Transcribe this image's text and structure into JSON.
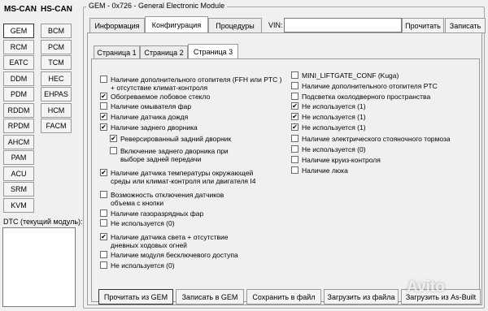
{
  "buses": {
    "ms_can": "MS-CAN",
    "hs_can": "HS-CAN"
  },
  "ms_modules": [
    "GEM",
    "RCM",
    "EATC",
    "DDM",
    "PDM",
    "RDDM",
    "RPDM",
    "AHCM",
    "PAM",
    "ACU",
    "SRM",
    "KVM"
  ],
  "hs_modules": [
    "BCM",
    "PCM",
    "TCM",
    "HEC",
    "EHPAS",
    "HCM",
    "FACM"
  ],
  "dtc_label": "DTC (текущий модуль):",
  "module_title": "GEM - 0x726 - General Electronic Module",
  "tabs": [
    "Информация",
    "Конфигурация",
    "Процедуры"
  ],
  "vin_label": "VIN:",
  "vin_value": "",
  "read_button": "Прочитать",
  "write_button": "Записать",
  "subtabs": [
    "Страница 1",
    "Страница 2",
    "Страница 3"
  ],
  "left_options": [
    {
      "label": "Наличие дополнительного отопителя (FFH или PTC )",
      "label2": "+ отсутствие климат-контроля",
      "checked": false
    },
    {
      "label": "Обогреваемое лобовое стекло",
      "checked": true
    },
    {
      "label": "Наличие омывателя фар",
      "checked": false
    },
    {
      "label": "Наличие датчика дождя",
      "checked": true
    },
    {
      "label": "Наличие заднего дворника",
      "checked": true
    },
    {
      "label": "Реверсированный задний дворник",
      "checked": true
    },
    {
      "label": "Включение заднего дворника при",
      "label2": "выборе задней передачи",
      "checked": false
    },
    {
      "label": "Наличие датчика температуры окружающей",
      "label2": "среды или климат-контроля или двигателя I4",
      "checked": true
    },
    {
      "label": "Возможность отключения датчиков",
      "label2": "объема с кнопки",
      "checked": false
    },
    {
      "label": "Наличие газоразрядных фар",
      "checked": false
    },
    {
      "label": "Не используется (0)",
      "checked": false
    },
    {
      "label": "Наличие датчика света + отсутствие",
      "label2": "дневных ходовых огней",
      "checked": true
    },
    {
      "label": "Наличие модуля бесключевого доступа",
      "checked": false
    },
    {
      "label": "Не используется (0)",
      "checked": false
    }
  ],
  "right_options": [
    {
      "label": "MINI_LIFTGATE_CONF (Kuga)",
      "checked": false
    },
    {
      "label": "Наличие дополнительного отопителя PTC",
      "checked": false
    },
    {
      "label": "Подсветка околодверного пространства",
      "checked": false
    },
    {
      "label": "Не используется (1)",
      "checked": true
    },
    {
      "label": "Не используется (1)",
      "checked": true
    },
    {
      "label": "Не используется (1)",
      "checked": true
    },
    {
      "label": "Наличие электрического стояночного тормоза",
      "checked": false
    },
    {
      "label": "Не используется (0)",
      "checked": false
    },
    {
      "label": "Наличие круиз-контроля",
      "checked": false
    },
    {
      "label": "Наличие люка",
      "checked": false
    }
  ],
  "bottom_buttons": [
    "Прочитать из GEM",
    "Записать в GEM",
    "Сохранить в файл",
    "Загрузить из файла",
    "Загрузить из As-Built"
  ],
  "watermark": "Avito"
}
